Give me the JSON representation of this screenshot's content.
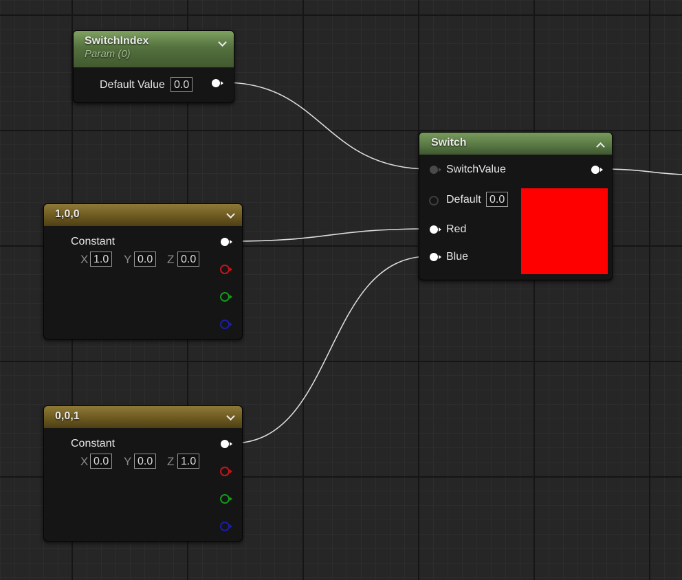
{
  "colors": {
    "wire": "#dcdcdc",
    "pin_red": "#c0171a",
    "pin_green": "#139a19",
    "pin_blue": "#1b1ea6",
    "preview": "#ff0000"
  },
  "switch_index": {
    "title": "SwitchIndex",
    "subtitle": "Param (0)",
    "default_value_label": "Default Value",
    "default_value": "0.0"
  },
  "const_a": {
    "title": "1,0,0",
    "output_label": "Constant",
    "x_label": "X",
    "x": "1.0",
    "y_label": "Y",
    "y": "0.0",
    "z_label": "Z",
    "z": "0.0"
  },
  "const_b": {
    "title": "0,0,1",
    "output_label": "Constant",
    "x_label": "X",
    "x": "0.0",
    "y_label": "Y",
    "y": "0.0",
    "z_label": "Z",
    "z": "1.0"
  },
  "switch": {
    "title": "Switch",
    "switch_value_label": "SwitchValue",
    "default_label": "Default",
    "default_value": "0.0",
    "red_label": "Red",
    "blue_label": "Blue"
  }
}
